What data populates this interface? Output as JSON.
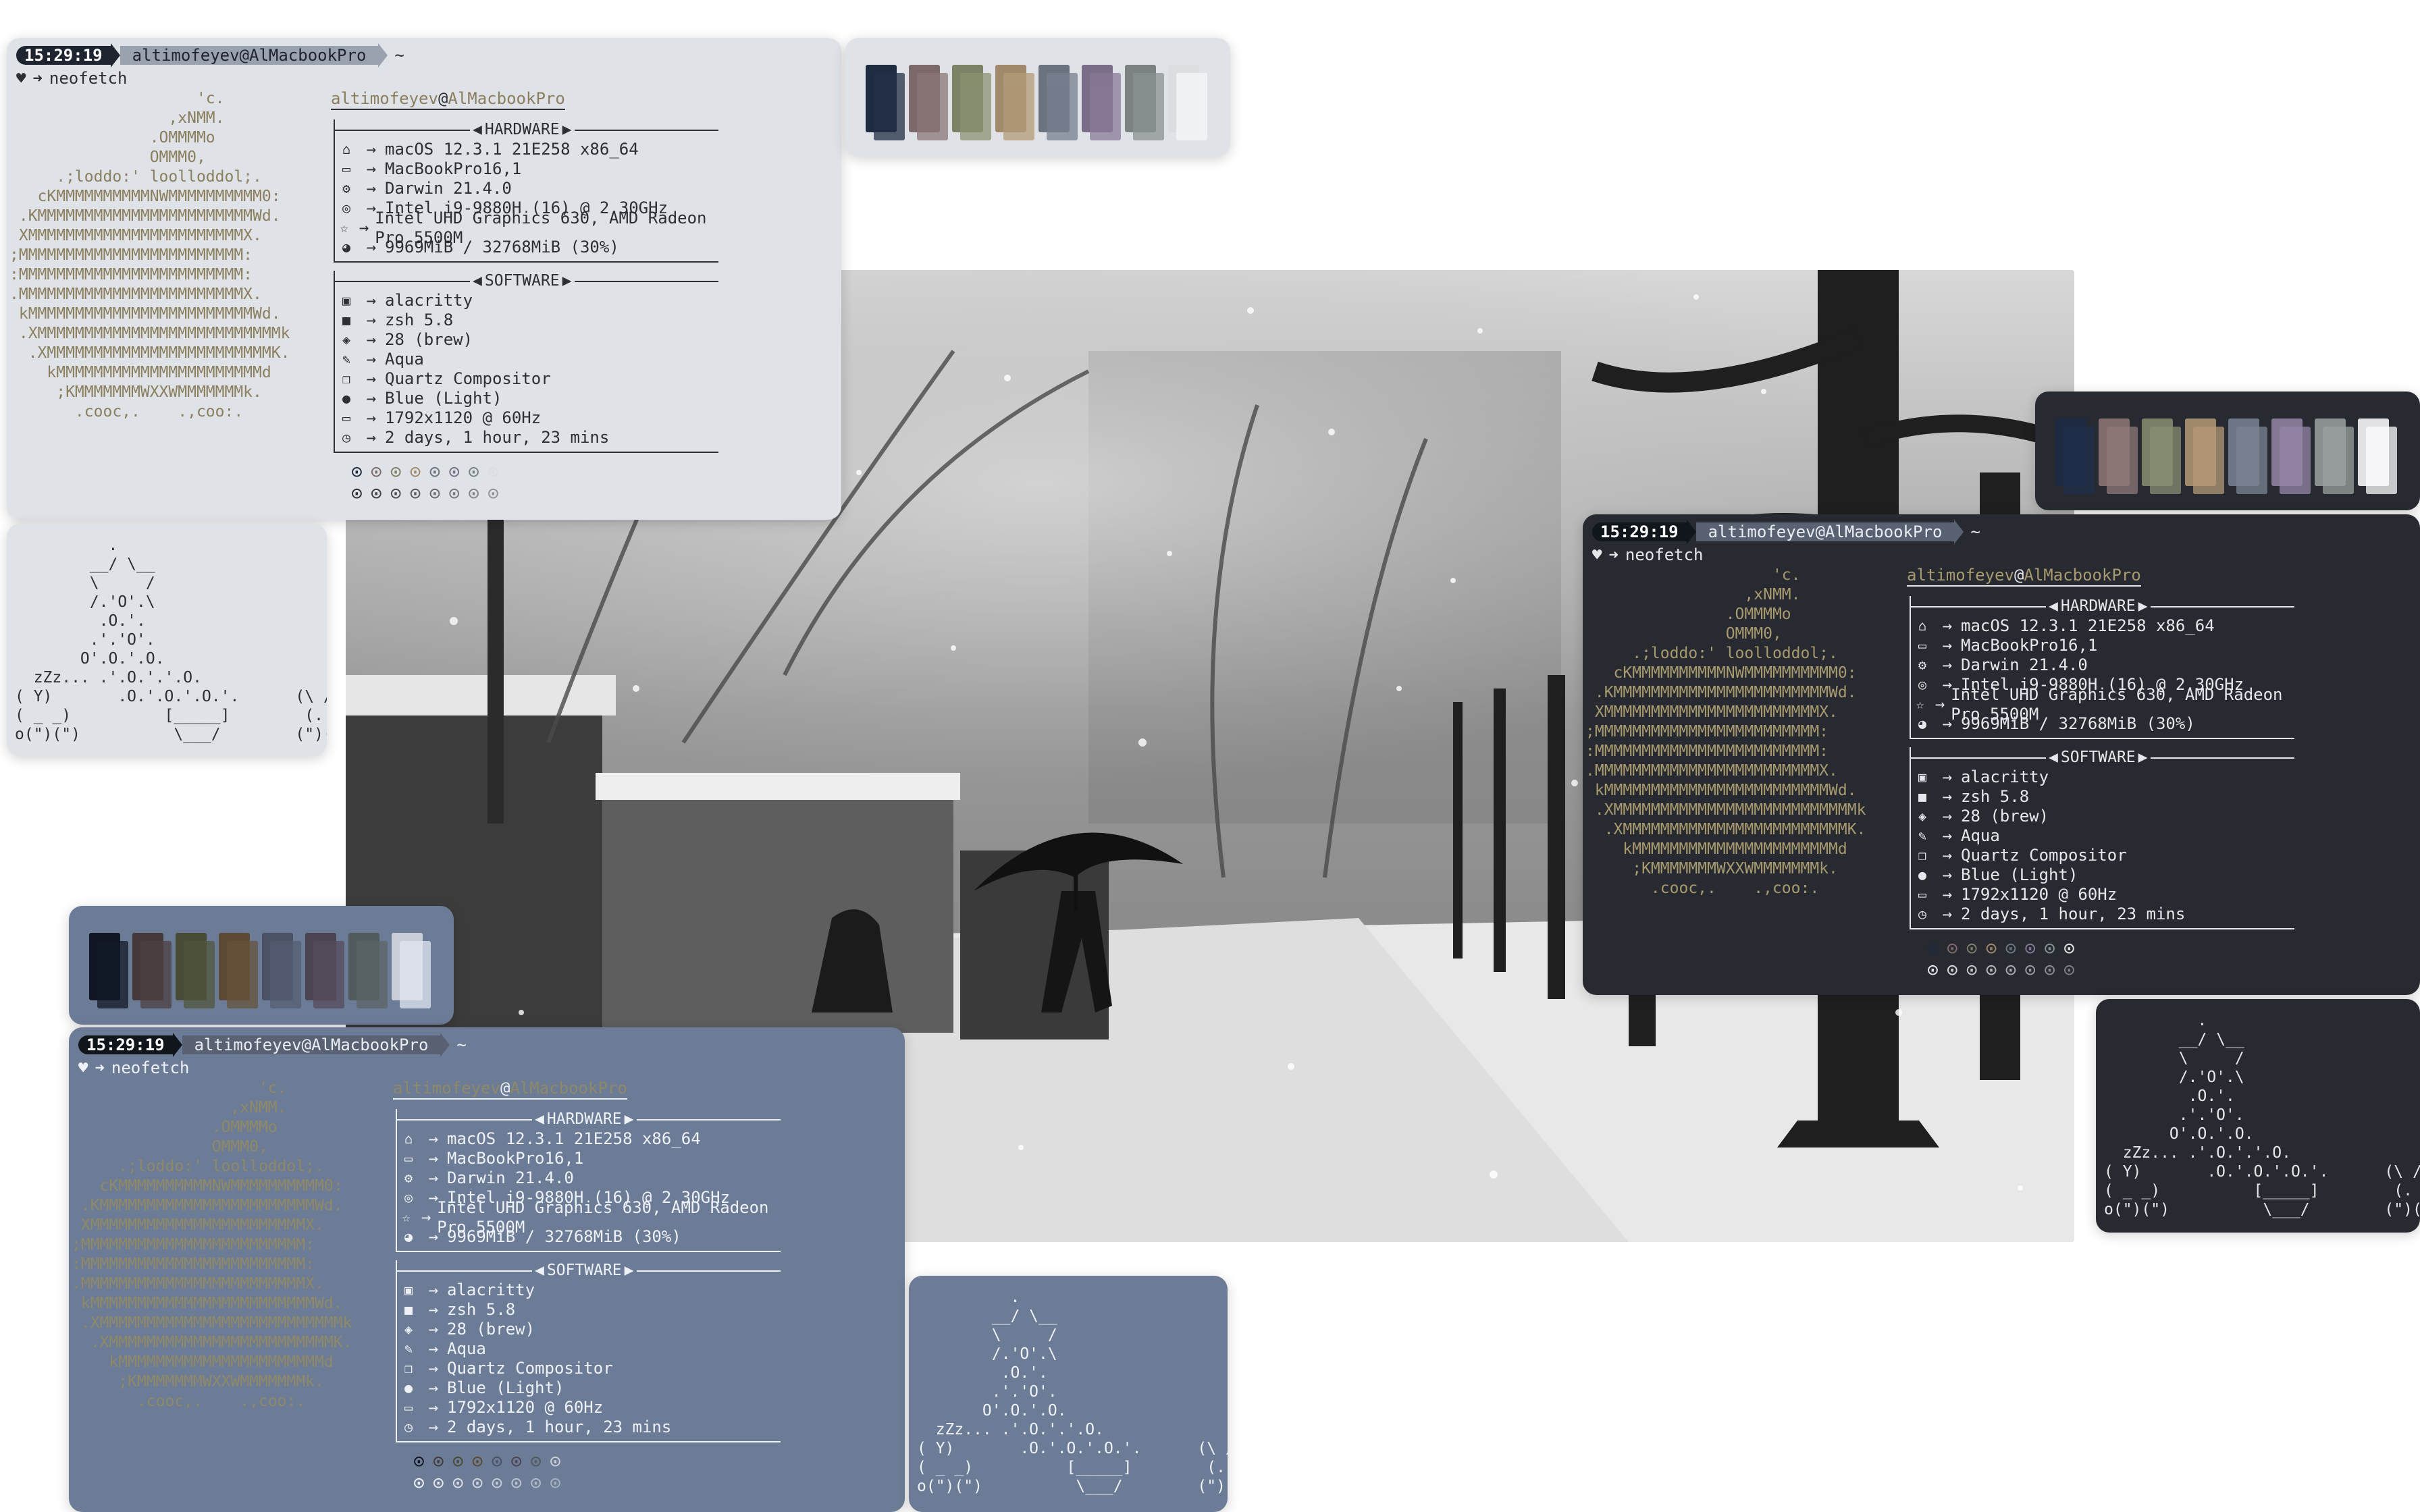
{
  "prompt": {
    "time": "15:29:19",
    "user": "altimofeyev",
    "at": "@",
    "host": "AlMacbookPro",
    "dir": "~",
    "heart": "♥",
    "arrow": "➜",
    "command": "neofetch"
  },
  "fetch": {
    "user": "altimofeyev",
    "at": "@",
    "host": "AlMacbookPro",
    "hardware_label": "HARDWARE",
    "software_label": "SOFTWARE",
    "hardware": [
      {
        "icon": "home-icon",
        "glyph": "⌂",
        "value": "macOS 12.3.1 21E258 x86_64"
      },
      {
        "icon": "laptop-icon",
        "glyph": "▭",
        "value": "MacBookPro16,1"
      },
      {
        "icon": "gear-icon",
        "glyph": "⚙",
        "value": "Darwin 21.4.0"
      },
      {
        "icon": "cpu-icon",
        "glyph": "◎",
        "value": "Intel i9-9880H (16) @ 2.30GHz"
      },
      {
        "icon": "star-icon",
        "glyph": "☆",
        "value": "Intel UHD Graphics 630, AMD Radeon Pro 5500M"
      },
      {
        "icon": "pie-chart-icon",
        "glyph": "◕",
        "value": "9969MiB / 32768MiB (30%)"
      }
    ],
    "software": [
      {
        "icon": "terminal-icon",
        "glyph": "▣",
        "value": "alacritty"
      },
      {
        "icon": "shell-icon",
        "glyph": "■",
        "value": "zsh 5.8"
      },
      {
        "icon": "package-icon",
        "glyph": "◈",
        "value": "28 (brew)"
      },
      {
        "icon": "brush-icon",
        "glyph": "✎",
        "value": "Aqua"
      },
      {
        "icon": "windows-icon",
        "glyph": "❐",
        "value": "Quartz Compositor"
      },
      {
        "icon": "droplet-icon",
        "glyph": "●",
        "value": "Blue (Light)"
      },
      {
        "icon": "monitor-icon",
        "glyph": "▭",
        "value": "1792x1120 @ 60Hz"
      },
      {
        "icon": "clock-icon",
        "glyph": "◷",
        "value": "2 days, 1 hour, 23 mins"
      }
    ],
    "logo": [
      "                    'c.",
      "                 ,xNMM.",
      "               .OMMMMo",
      "               OMMM0,",
      "     .;loddo:' loolloddol;.",
      "   cKMMMMMMMMMMNWMMMMMMMMMM0:",
      " .KMMMMMMMMMMMMMMMMMMMMMMMWd.",
      " XMMMMMMMMMMMMMMMMMMMMMMMX.",
      ";MMMMMMMMMMMMMMMMMMMMMMMM:",
      ":MMMMMMMMMMMMMMMMMMMMMMMM:",
      ".MMMMMMMMMMMMMMMMMMMMMMMMX.",
      " kMMMMMMMMMMMMMMMMMMMMMMMMWd.",
      " .XMMMMMMMMMMMMMMMMMMMMMMMMMMk",
      "  .XMMMMMMMMMMMMMMMMMMMMMMMMK.",
      "    kMMMMMMMMMMMMMMMMMMMMMMd",
      "     ;KMMMMMMMWXXWMMMMMMMk.",
      "       .cooc,.    .,coo:."
    ],
    "dot_glyph": "⊙"
  },
  "tree": [
    "          .",
    "        __/ \\__",
    "        \\     /",
    "        /.'O'.\\",
    "         .O.'.",
    "        .'.'O'.",
    "       O'.O.'.O.",
    "  zZz... .'.O.'.'.O.",
    "( Y)       .O.'.O.'.O.'.      (\\ /)",
    "( _ _)          [_____]        (. . )",
    "o(\")(\")          \\___/        (\")(\")o"
  ],
  "themes": {
    "light": {
      "bg": "#dfe2e7",
      "fg": "#2d2f33",
      "logo": "#8a7f5e",
      "pal": [
        "#1f2b40",
        "#7c6a6a",
        "#7c8266",
        "#a08a6b",
        "#6b7280",
        "#7a6d87",
        "#7c8282",
        "#dcdde0"
      ],
      "accent": "#3a3d44"
    },
    "dark": {
      "bg": "#272a30",
      "fg": "#e6e7ea",
      "logo": "#a89a6f",
      "pal": [
        "#1d2a42",
        "#816c6c",
        "#7a8068",
        "#a1896c",
        "#6e7685",
        "#857897",
        "#8a9090",
        "#e2e2e4"
      ],
      "accent": "#c8cbd2"
    },
    "blue": {
      "bg": "#6c7c96",
      "fg": "#eef1f6",
      "logo": "#8f8967",
      "pal": [
        "#101623",
        "#44393a",
        "#474b36",
        "#5c4a35",
        "#4b5265",
        "#4c4352",
        "#515a5c",
        "#c9ced8"
      ],
      "accent": "#1b2230"
    }
  },
  "photo": {
    "desc_colors": {
      "sky": "#c9c9c9",
      "ground": "#e5e5e5",
      "trees": "#2a2a2a"
    }
  }
}
